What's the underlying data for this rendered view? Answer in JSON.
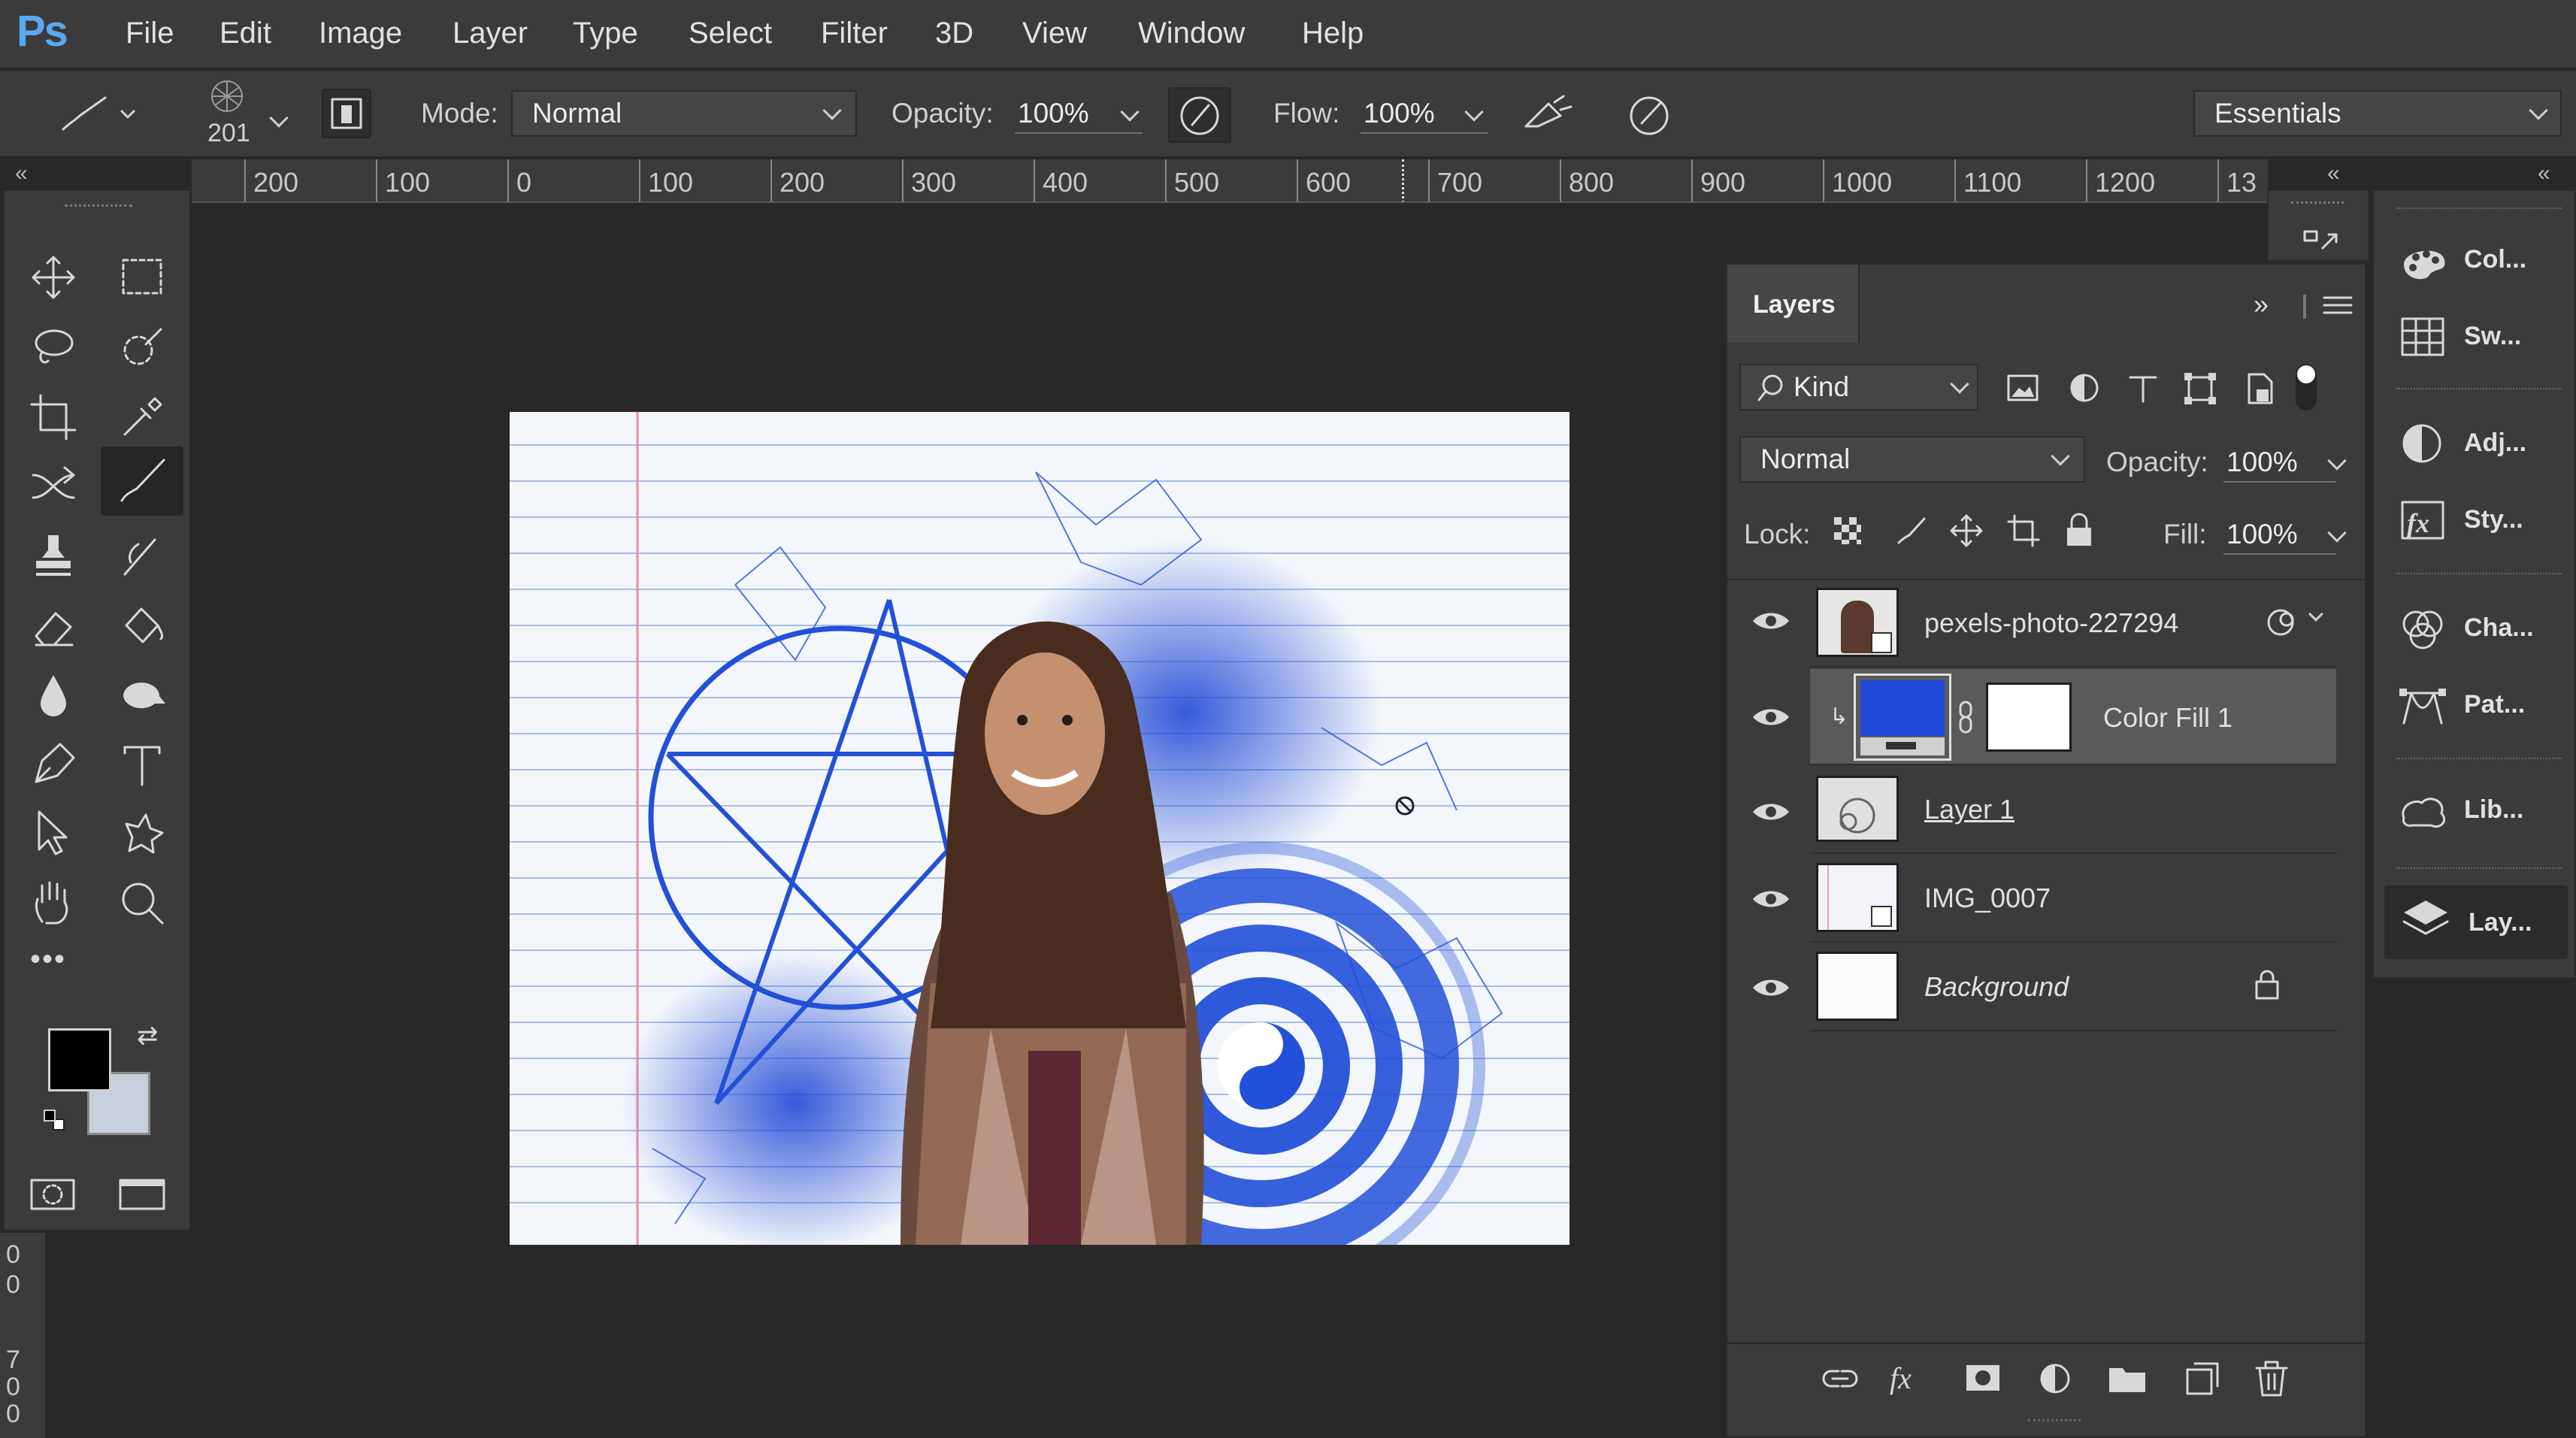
{
  "app": {
    "logo": "Ps"
  },
  "menu": [
    "File",
    "Edit",
    "Image",
    "Layer",
    "Type",
    "Select",
    "Filter",
    "3D",
    "View",
    "Window",
    "Help"
  ],
  "options": {
    "brush_size": "201",
    "mode_label": "Mode:",
    "mode_value": "Normal",
    "opacity_label": "Opacity:",
    "opacity_value": "100%",
    "flow_label": "Flow:",
    "flow_value": "100%",
    "workspace": "Essentials"
  },
  "ruler": {
    "h_labels": [
      "200",
      "100",
      "0",
      "100",
      "200",
      "300",
      "400",
      "500",
      "600",
      "700",
      "800",
      "900",
      "1000",
      "1100",
      "1200",
      "13"
    ],
    "v_labels": [
      "0",
      "0",
      "7",
      "0",
      "0"
    ]
  },
  "tools": {
    "icons": [
      "move-tool-icon",
      "marquee-tool-icon",
      "lasso-tool-icon",
      "quick-selection-tool-icon",
      "crop-tool-icon",
      "eyedropper-tool-icon",
      "healing-brush-tool-icon",
      "brush-tool-icon",
      "clone-stamp-tool-icon",
      "history-brush-tool-icon",
      "eraser-tool-icon",
      "paint-bucket-tool-icon",
      "blur-tool-icon",
      "dodge-tool-icon",
      "pen-tool-icon",
      "type-tool-icon",
      "path-selection-tool-icon",
      "custom-shape-tool-icon",
      "hand-tool-icon",
      "zoom-tool-icon"
    ],
    "more_label": "•••",
    "foreground_color": "#000000",
    "background_color": "#c8cfdc"
  },
  "layers_panel": {
    "tab_title": "Layers",
    "filter_kind": "Kind",
    "blend_mode": "Normal",
    "opacity_label": "Opacity:",
    "opacity_value": "100%",
    "lock_label": "Lock:",
    "fill_label": "Fill:",
    "fill_value": "100%",
    "layers": [
      {
        "name": "pexels-photo-227294",
        "visible": true,
        "selected": false
      },
      {
        "name": "Color Fill 1",
        "visible": true,
        "selected": true,
        "fill_color": "#1f49d6"
      },
      {
        "name": "Layer 1",
        "visible": true,
        "selected": false
      },
      {
        "name": "IMG_0007",
        "visible": true,
        "selected": false
      },
      {
        "name": "Background",
        "visible": true,
        "selected": false,
        "locked": true
      }
    ],
    "footer_icons": [
      "link-layers-icon",
      "fx-icon",
      "add-mask-icon",
      "adjustment-layer-icon",
      "group-folder-icon",
      "new-layer-icon",
      "trash-icon"
    ]
  },
  "dock": {
    "items": [
      {
        "label": "Col...",
        "icon": "color-palette-icon"
      },
      {
        "label": "Sw...",
        "icon": "swatches-grid-icon"
      },
      {
        "label": "Adj...",
        "icon": "adjustments-icon"
      },
      {
        "label": "Sty...",
        "icon": "styles-fx-icon"
      },
      {
        "label": "Cha...",
        "icon": "channels-icon"
      },
      {
        "label": "Pat...",
        "icon": "paths-icon"
      },
      {
        "label": "Lib...",
        "icon": "libraries-icon"
      },
      {
        "label": "Lay...",
        "icon": "layers-stack-icon"
      }
    ]
  },
  "colors": {
    "accent": "#1f49d6",
    "panel": "#3b3b3b",
    "workspace": "#282828"
  }
}
